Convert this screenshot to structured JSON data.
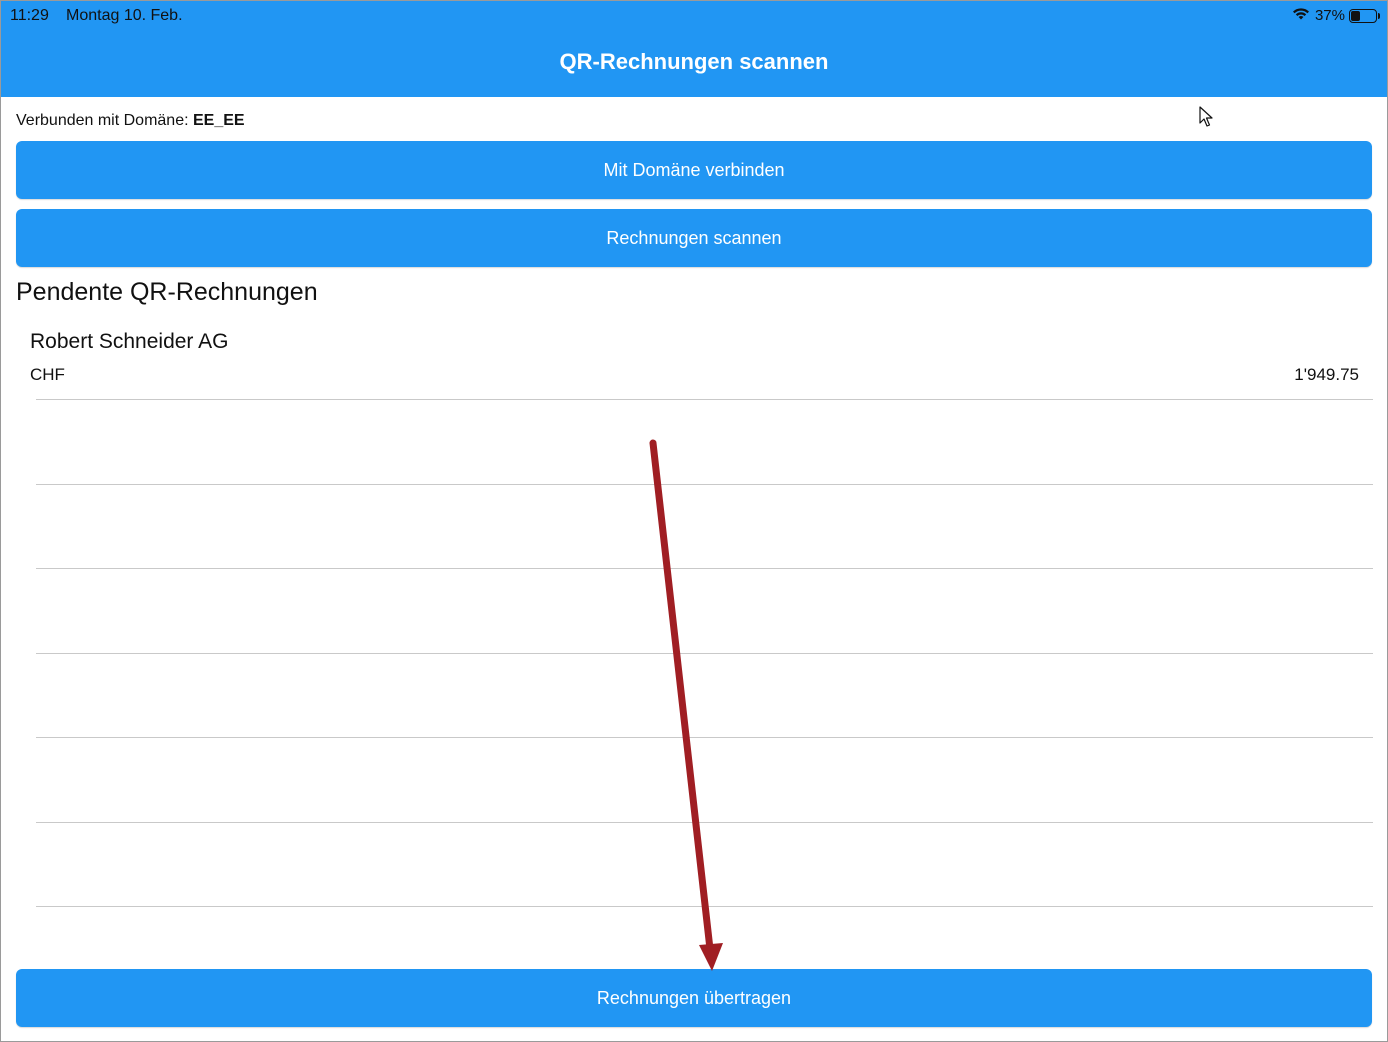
{
  "status_bar": {
    "time": "11:29",
    "date": "Montag 10. Feb.",
    "battery": "37%",
    "battery_level": 0.37
  },
  "header": {
    "title": "QR-Rechnungen scannen"
  },
  "domain": {
    "label": "Verbunden mit Domäne:",
    "value": "EE_EE"
  },
  "buttons": {
    "connect": "Mit Domäne verbinden",
    "scan": "Rechnungen scannen",
    "transfer": "Rechnungen übertragen"
  },
  "list": {
    "title": "Pendente QR-Rechnungen",
    "items": [
      {
        "name": "Robert Schneider AG",
        "currency": "CHF",
        "amount": "1'949.75"
      }
    ]
  },
  "colors": {
    "accent": "#2196F3",
    "annotation_arrow": "#A01E23"
  }
}
